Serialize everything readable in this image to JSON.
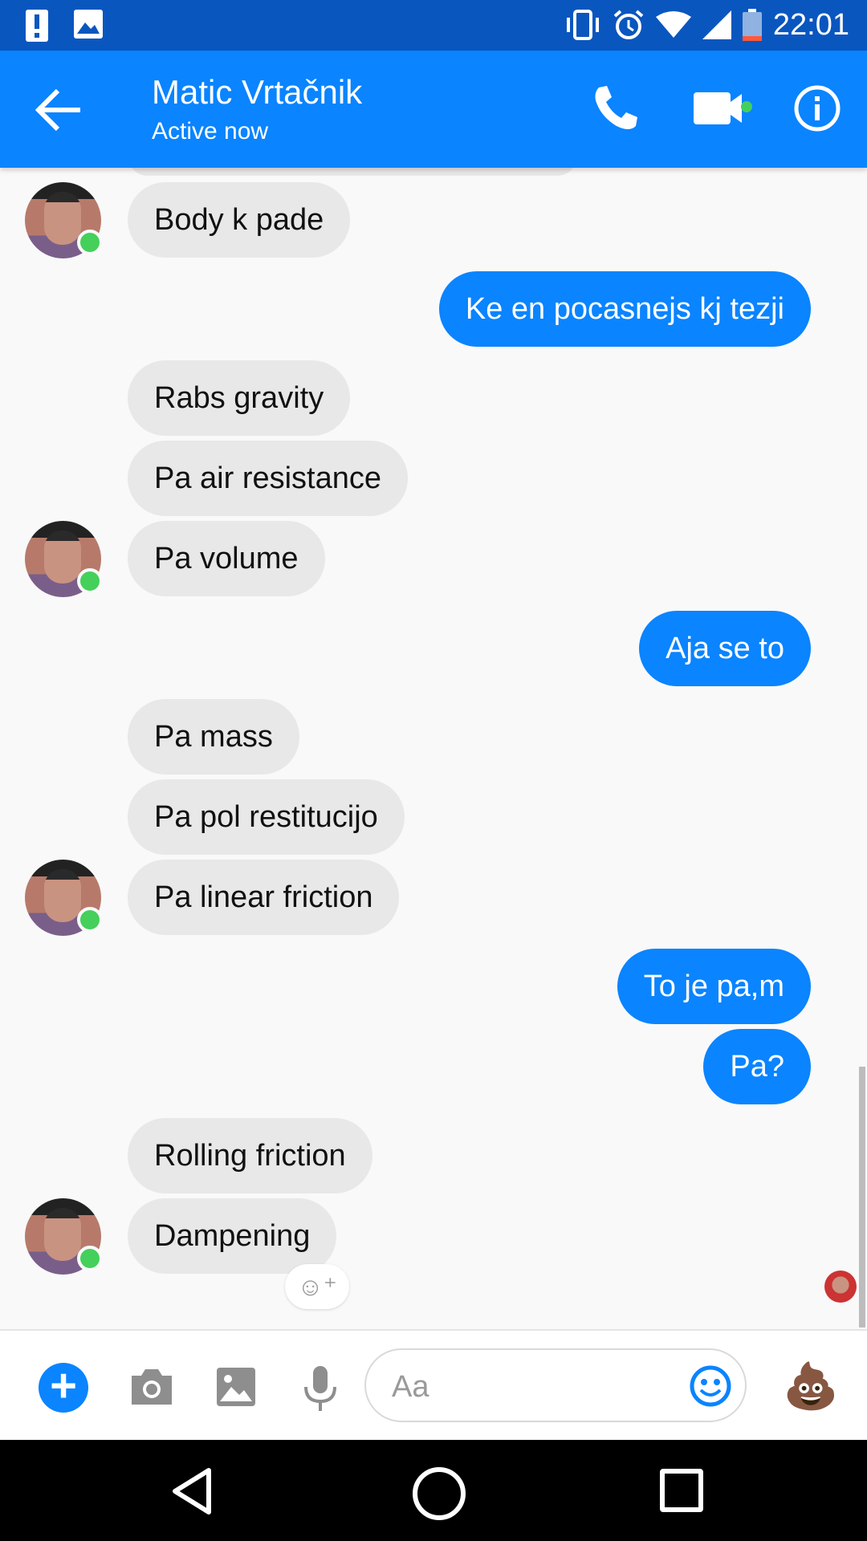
{
  "status_bar": {
    "time": "22:01",
    "icons_left": [
      "alert-icon",
      "image-notification-icon"
    ],
    "icons_right": [
      "vibrate-icon",
      "alarm-icon",
      "wifi-icon",
      "signal-icon",
      "battery-icon"
    ]
  },
  "header": {
    "contact_name": "Matic Vrtačnik",
    "contact_status": "Active now",
    "icons": [
      "back-arrow-icon",
      "phone-icon",
      "video-camera-icon",
      "info-icon"
    ]
  },
  "messages": [
    {
      "side": "received",
      "text": "Body k pade"
    },
    {
      "side": "sent",
      "text": "Ke en pocasnejs kj tezji"
    },
    {
      "side": "received",
      "text": "Rabs gravity"
    },
    {
      "side": "received",
      "text": "Pa air resistance"
    },
    {
      "side": "received",
      "text": "Pa volume"
    },
    {
      "side": "sent",
      "text": "Aja se to"
    },
    {
      "side": "received",
      "text": "Pa mass"
    },
    {
      "side": "received",
      "text": "Pa pol restitucijo"
    },
    {
      "side": "received",
      "text": "Pa linear friction"
    },
    {
      "side": "sent",
      "text": "To je pa,m"
    },
    {
      "side": "sent",
      "text": "Pa?"
    },
    {
      "side": "received",
      "text": "Rolling friction"
    },
    {
      "side": "received",
      "text": "Dampening"
    }
  ],
  "composer": {
    "placeholder": "Aa",
    "icons": [
      "plus-icon",
      "camera-icon",
      "gallery-icon",
      "microphone-icon",
      "emoji-icon",
      "poop-emoji-icon"
    ]
  },
  "colors": {
    "status_bar": "#0a56bf",
    "header": "#0a84ff",
    "sent_bubble": "#0a84ff",
    "received_bubble": "#e8e8e8",
    "online": "#44d05b"
  }
}
